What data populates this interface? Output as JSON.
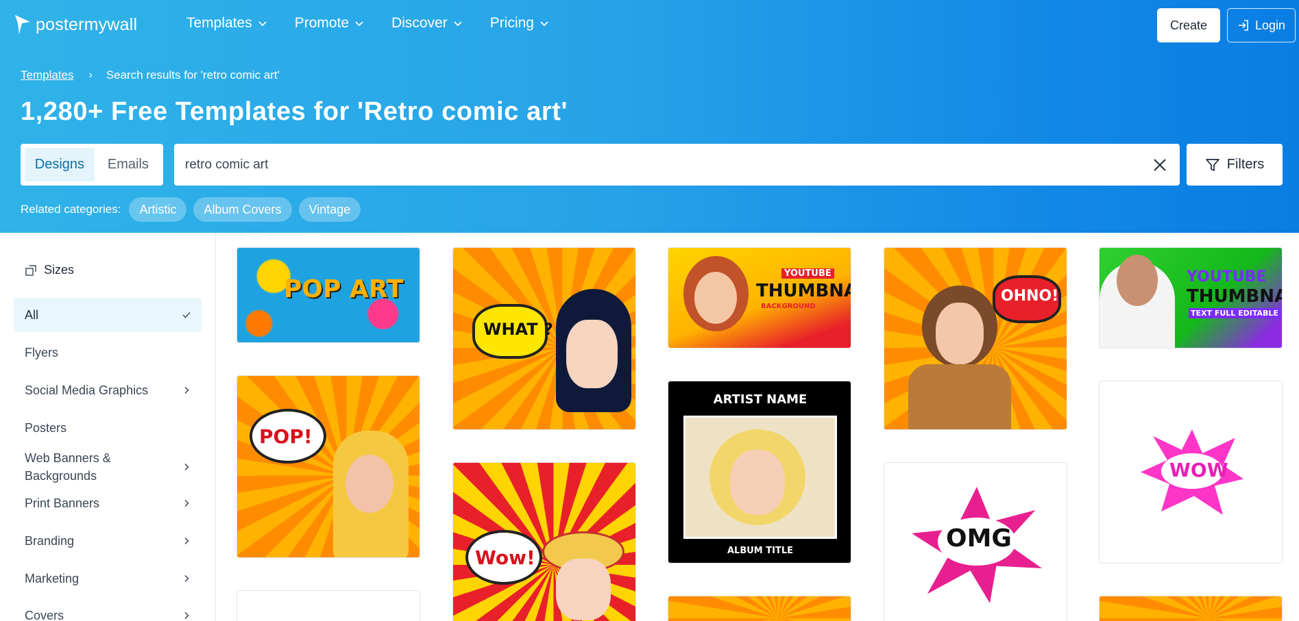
{
  "brand": {
    "name": "postermywall"
  },
  "nav": {
    "menu": [
      {
        "label": "Templates"
      },
      {
        "label": "Promote"
      },
      {
        "label": "Discover"
      },
      {
        "label": "Pricing"
      }
    ],
    "create_label": "Create",
    "login_label": "Login"
  },
  "breadcrumb": {
    "root": "Templates",
    "current": "Search results for 'retro comic art'"
  },
  "page_title": "1,280+ Free Templates for 'Retro comic art'",
  "search": {
    "tabs": [
      {
        "label": "Designs",
        "active": true
      },
      {
        "label": "Emails",
        "active": false
      }
    ],
    "value": "retro comic art",
    "filters_label": "Filters"
  },
  "related": {
    "label": "Related categories:",
    "chips": [
      "Artistic",
      "Album Covers",
      "Vintage"
    ]
  },
  "sidebar": {
    "heading": "Sizes",
    "items": [
      {
        "label": "All",
        "active": true
      },
      {
        "label": "Flyers"
      },
      {
        "label": "Social Media Graphics"
      },
      {
        "label": "Posters"
      },
      {
        "label": "Web Banners & Backgrounds"
      },
      {
        "label": "Print Banners"
      },
      {
        "label": "Branding"
      },
      {
        "label": "Marketing"
      },
      {
        "label": "Covers"
      }
    ]
  },
  "templates": [
    {
      "text": "POP ART"
    },
    {
      "text": "WHAT ?"
    },
    {
      "text": "YOUTUBE",
      "text2": "THUMBNAIL",
      "text3": "BACKGROUND"
    },
    {
      "text": "OHNO!"
    },
    {
      "text": "YOUTUBE",
      "text2": "THUMBNAIL",
      "text3": "TEXT FULL EDITABLE"
    },
    {
      "text": "POP!"
    },
    {
      "text": "ARTIST NAME",
      "text2": "ALBUM TITLE"
    },
    {
      "text": "WOW"
    },
    {
      "text": "Wow!"
    },
    {
      "text": "OMG"
    }
  ],
  "colors": {
    "accent": "#0a6fa8",
    "hero_start": "#2fb3e8",
    "hero_end": "#0a7de3"
  }
}
